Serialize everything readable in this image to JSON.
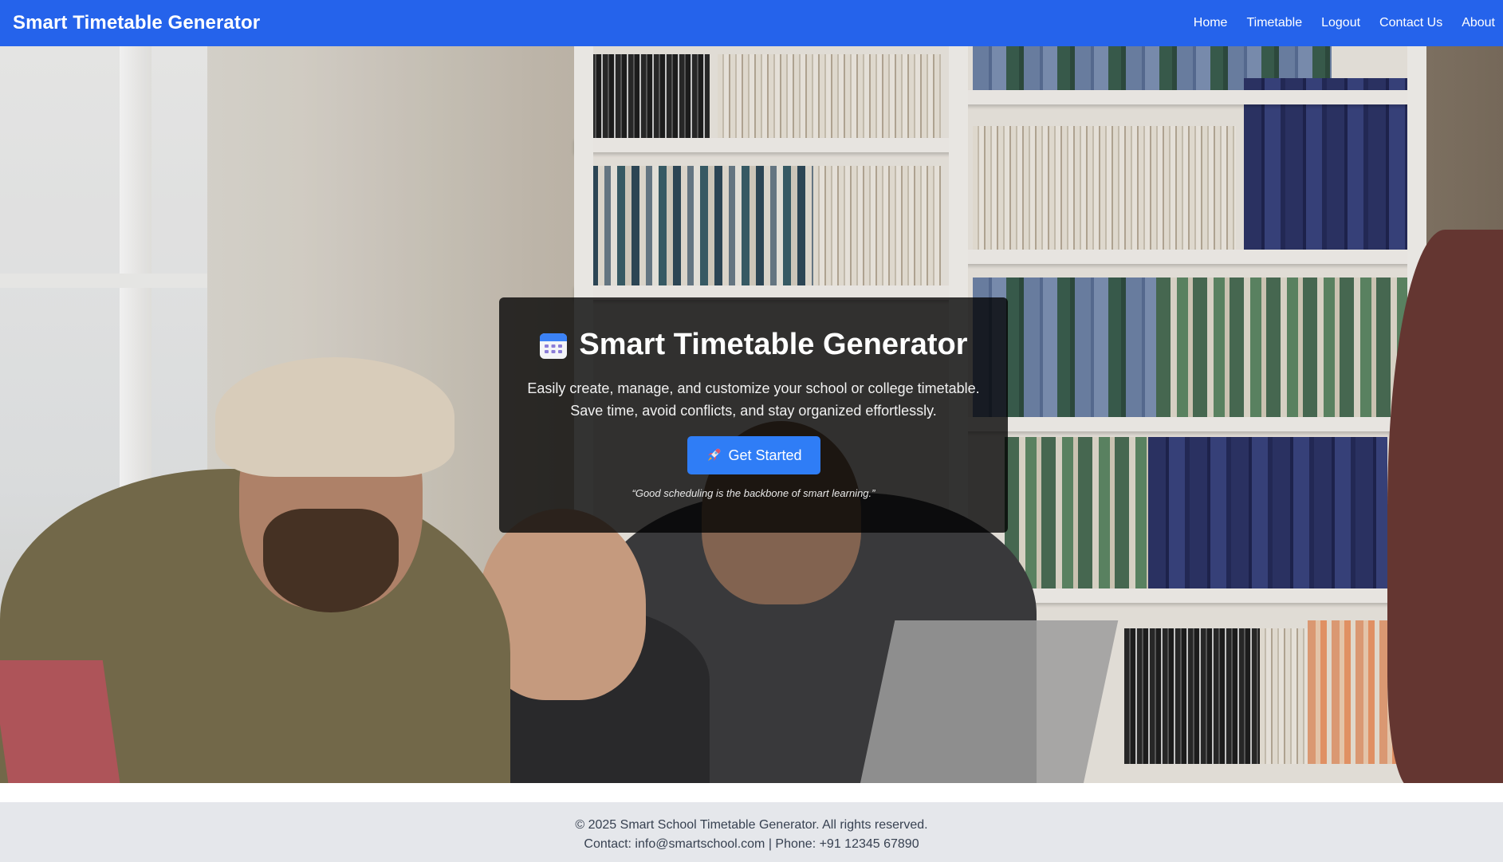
{
  "navbar": {
    "brand": "Smart Timetable Generator",
    "links": [
      "Home",
      "Timetable",
      "Logout",
      "Contact Us",
      "About"
    ]
  },
  "hero": {
    "icon": "calendar-icon",
    "title": "Smart Timetable Generator",
    "description_line1": "Easily create, manage, and customize your school or college timetable.",
    "description_line2": "Save time, avoid conflicts, and stay organized effortlessly.",
    "cta_icon": "rocket-icon",
    "cta_label": "Get Started",
    "quote": "“Good scheduling is the backbone of smart learning.”"
  },
  "footer": {
    "copyright": "© 2025 Smart School Timetable Generator. All rights reserved.",
    "contact": "Contact: info@smartschool.com | Phone: +91 12345 67890"
  },
  "colors": {
    "navbar": "#2563eb",
    "cta": "#2f7df6",
    "footer_bg": "#e5e7eb",
    "footer_text": "#374151"
  }
}
